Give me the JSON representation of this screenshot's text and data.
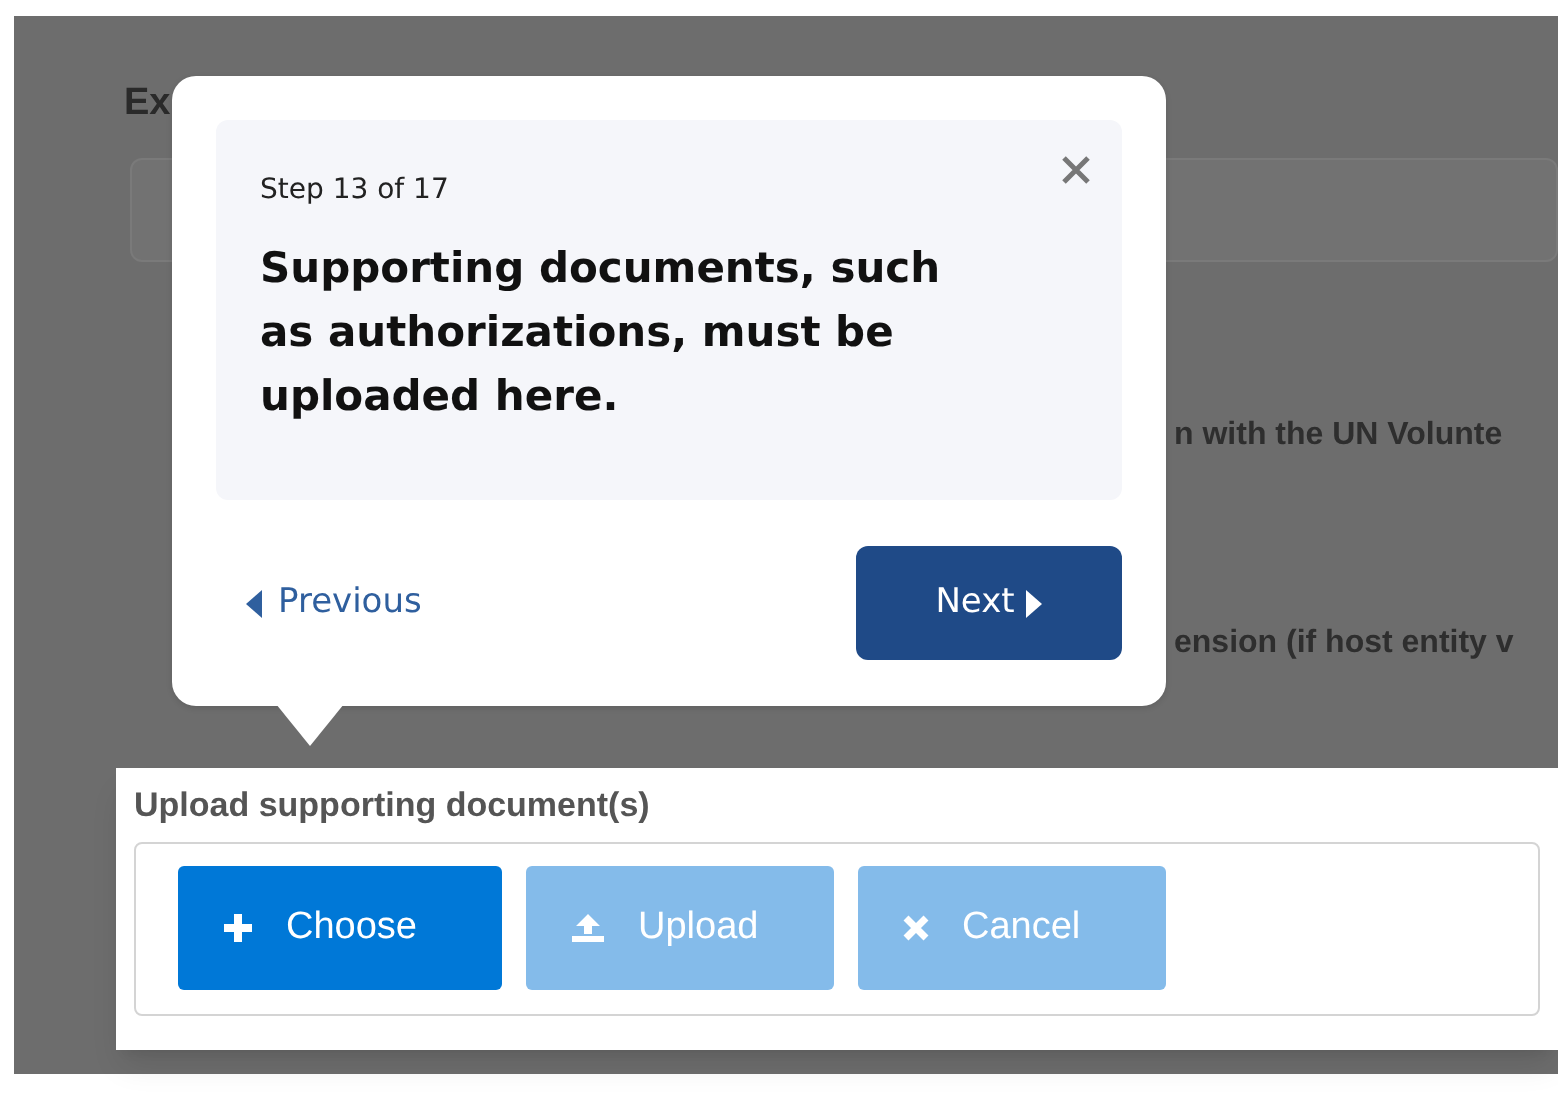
{
  "background": {
    "heading": "Ex",
    "lines": [
      "n with the UN Volunte",
      "ension (if host entity v"
    ]
  },
  "tour": {
    "step": "Step 13 of 17",
    "message": "Supporting documents, such as authorizations, must be uploaded here.",
    "previous": "Previous",
    "next": "Next"
  },
  "upload": {
    "title": "Upload supporting document(s)",
    "buttons": [
      {
        "label": "Choose",
        "kind": "choose",
        "disabled": false
      },
      {
        "label": "Upload",
        "kind": "upload",
        "disabled": true
      },
      {
        "label": "Cancel",
        "kind": "cancel",
        "disabled": true
      }
    ]
  }
}
